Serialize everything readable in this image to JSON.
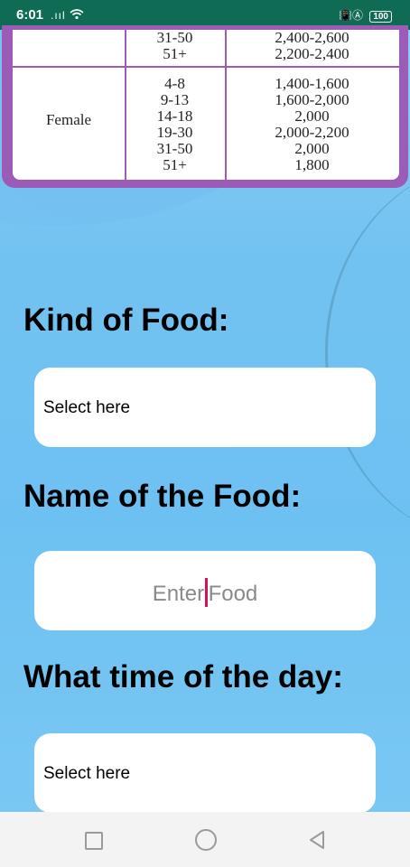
{
  "status_bar": {
    "time": "6:01",
    "signal": ".ııl",
    "wifi": "wifi-icon",
    "right_icons": "📳Ⓐ",
    "battery": "100"
  },
  "table": {
    "top_rows": {
      "ages": [
        "31-50",
        "51+"
      ],
      "calories": [
        "2,400-2,600",
        "2,200-2,400"
      ]
    },
    "female": {
      "label": "Female",
      "ages": [
        "4-8",
        "9-13",
        "14-18",
        "19-30",
        "31-50",
        "51+"
      ],
      "calories": [
        "1,400-1,600",
        "1,600-2,000",
        "2,000",
        "2,000-2,200",
        "2,000",
        "1,800"
      ]
    }
  },
  "form": {
    "kind_label": "Kind of Food:",
    "kind_value": "Select here",
    "name_label": "Name of the Food:",
    "name_placeholder_a": "Enter",
    "name_placeholder_b": "Food",
    "time_label": "What time of the day:",
    "time_value": "Select here"
  },
  "colors": {
    "status_bar": "#0f6b54",
    "table_border": "#9c5bb7",
    "background": "#7cc6f2",
    "cursor": "#d1135f"
  }
}
